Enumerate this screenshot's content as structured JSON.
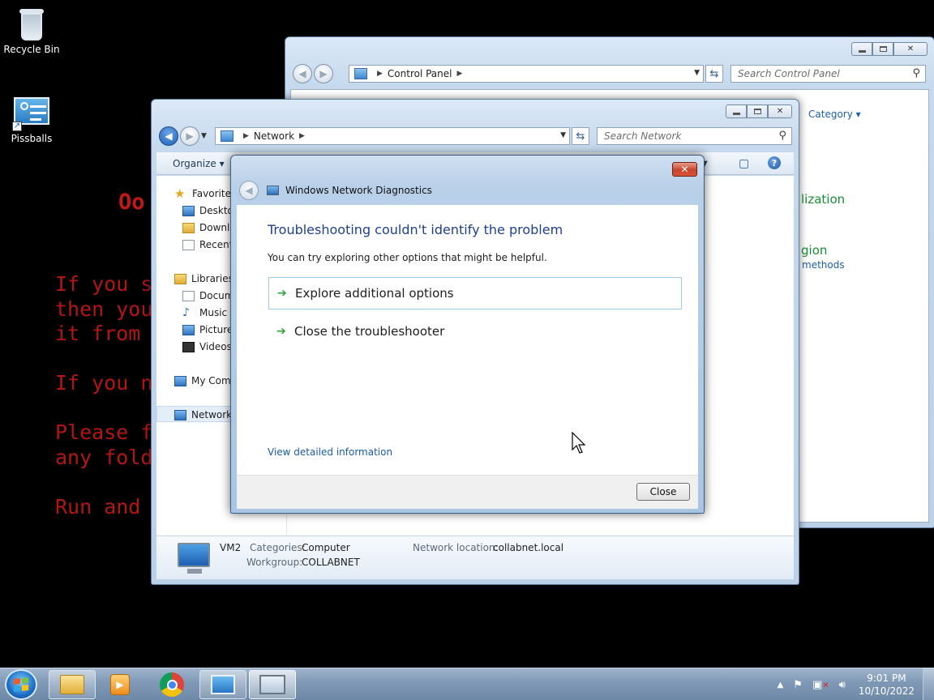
{
  "desktop": {
    "icons": [
      {
        "label": "Recycle Bin",
        "icon": "recycle-bin-icon"
      },
      {
        "label": "Pissballs",
        "icon": "control-panel-shortcut-icon"
      }
    ],
    "ransom_title": "Oo",
    "ransom_lines": "If you s\nthen you\nit from \n\nIf you n\n\nPlease f\nany fold\n\nRun and"
  },
  "control_panel": {
    "address_crumb": "Control Panel",
    "search_placeholder": "Search Control Panel",
    "view_by": "Category",
    "links": [
      "lization",
      "gion"
    ],
    "sublink": "methods"
  },
  "network_window": {
    "address_crumb": "Network",
    "search_placeholder": "Search Network",
    "organize": "Organize",
    "nav": {
      "favorites": "Favorites",
      "desktop": "Desktop",
      "downloads": "Downlo",
      "recent": "Recent",
      "libraries": "Libraries",
      "documents": "Docum",
      "music": "Music",
      "pictures": "Pictures",
      "videos": "Videos",
      "computer": "My Comp",
      "network": "Network"
    },
    "details": {
      "name": "VM2",
      "categories_label": "Categories:",
      "categories_value": "Computer",
      "workgroup_label": "Workgroup:",
      "workgroup_value": "COLLABNET",
      "location_label": "Network location:",
      "location_value": "collabnet.local"
    }
  },
  "dialog": {
    "title": "Windows Network Diagnostics",
    "headline": "Troubleshooting couldn't identify the problem",
    "subline": "You can try exploring other options that might be helpful.",
    "options": [
      "Explore additional options",
      "Close the troubleshooter"
    ],
    "detail_link": "View detailed information",
    "close_button": "Close",
    "close_x": "✕"
  },
  "taskbar": {
    "apps": [
      "windows-explorer-icon",
      "media-player-icon",
      "chrome-icon",
      "control-panel-icon",
      "network-diagnostics-icon"
    ],
    "clock_time": "9:01 PM",
    "clock_date": "10/10/2022"
  }
}
